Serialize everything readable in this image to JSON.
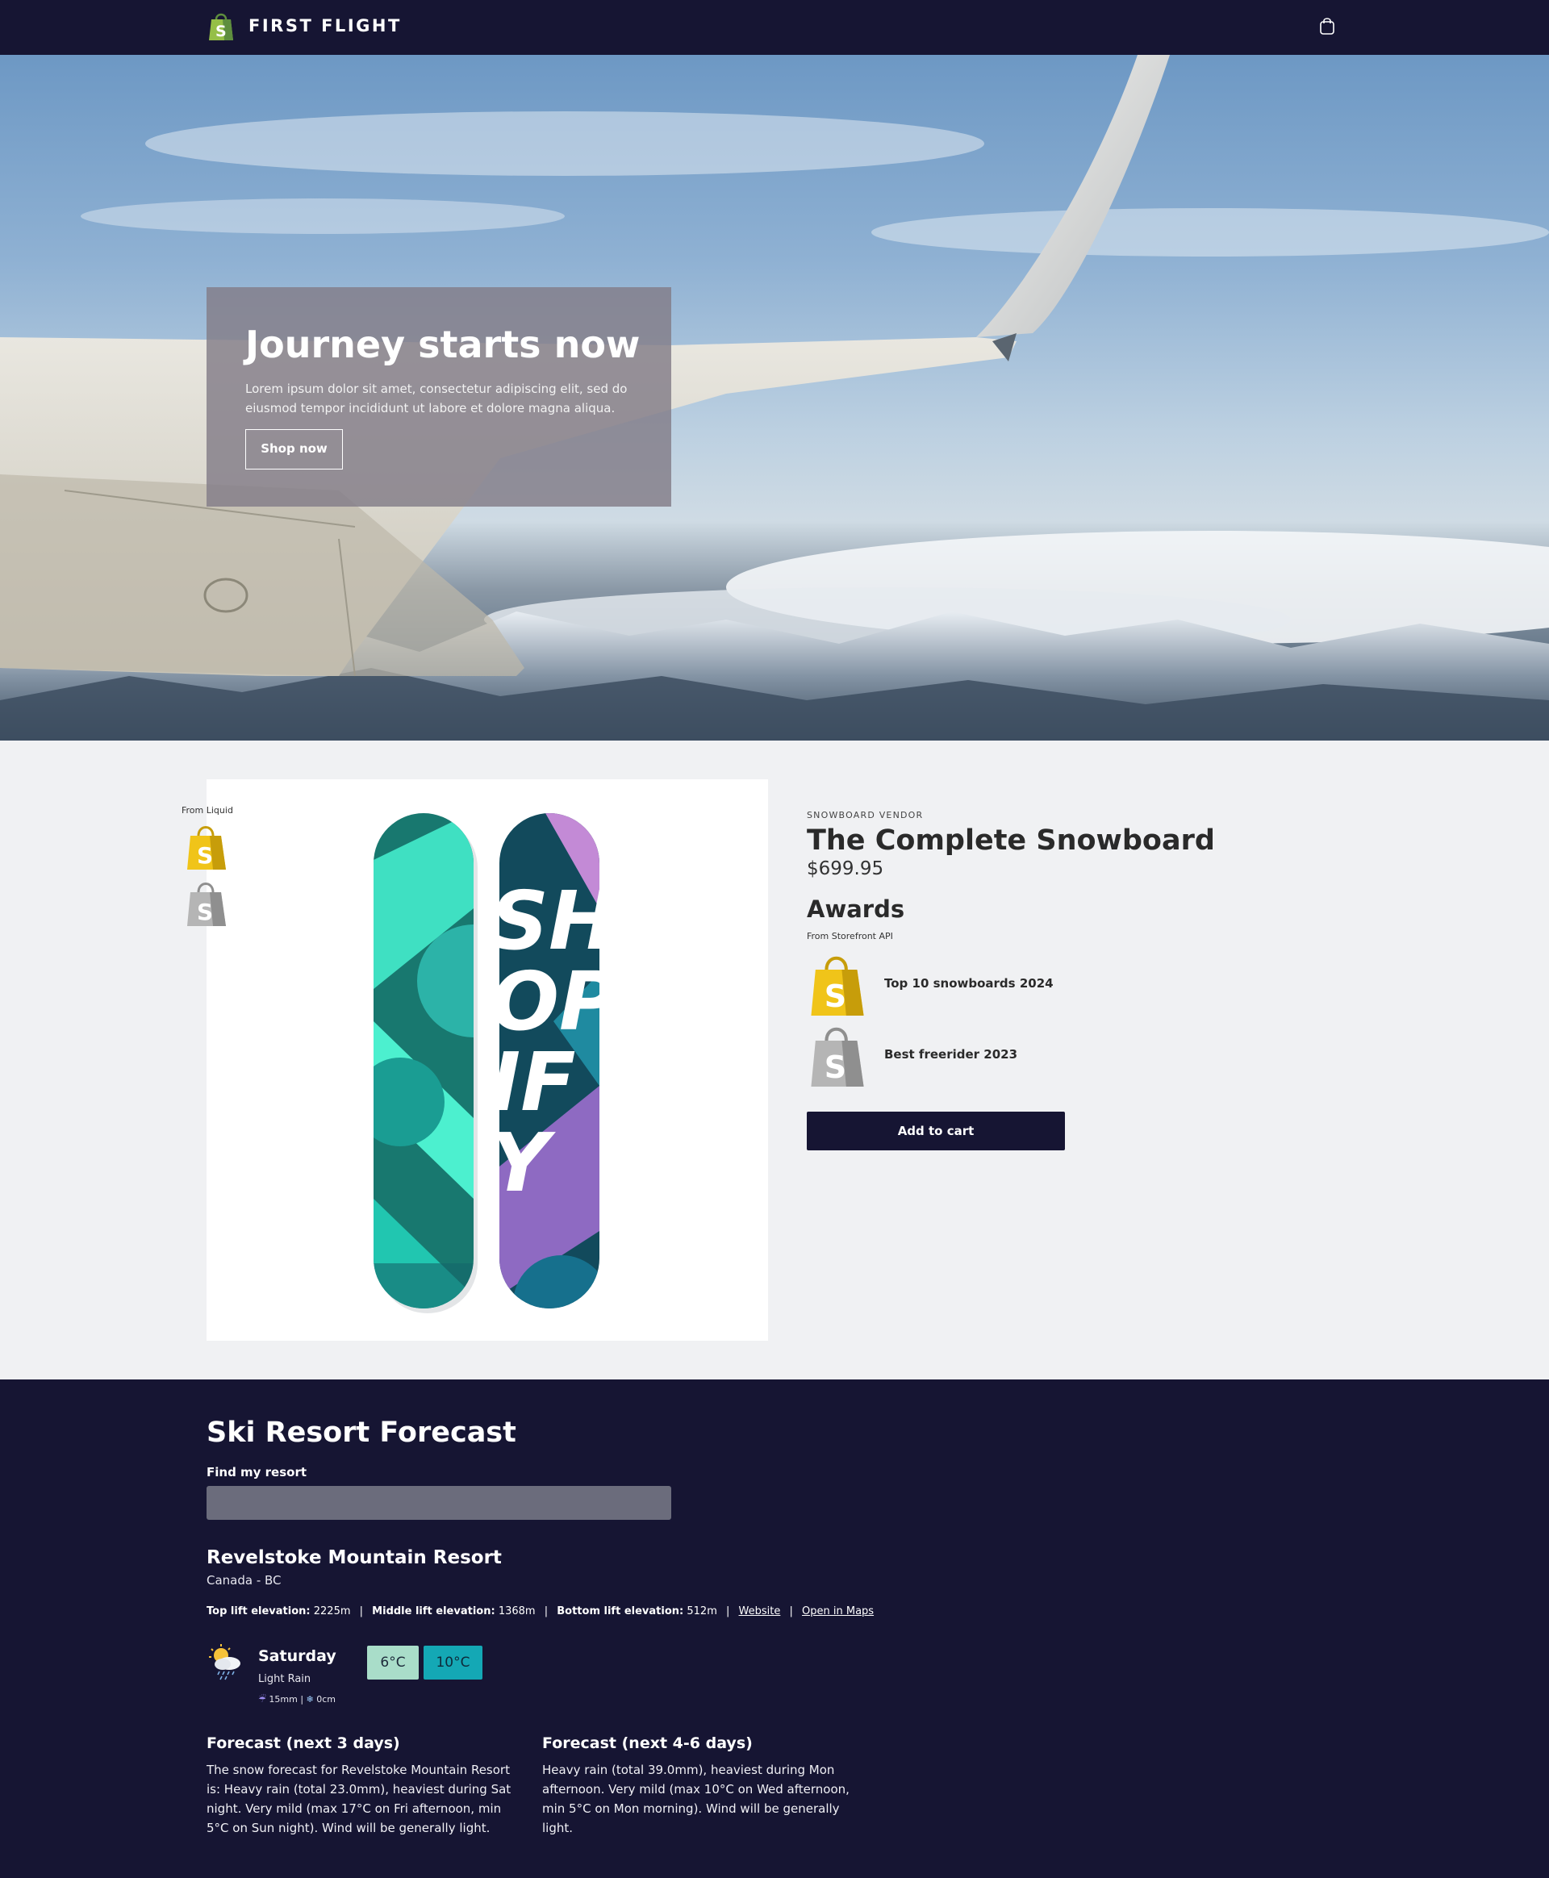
{
  "header": {
    "brand": "FIRST FLIGHT",
    "logo_icon": "shopify-bag-icon",
    "cart_icon": "shopping-bag-icon"
  },
  "hero": {
    "title": "Journey starts now",
    "text": "Lorem ipsum dolor sit amet, consectetur adipiscing elit, sed do eiusmod tempor incididunt ut labore et dolore magna aliqua.",
    "button": "Shop now"
  },
  "product": {
    "from_liquid": "From Liquid",
    "vendor": "SNOWBOARD VENDOR",
    "title": "The Complete Snowboard",
    "price": "$699.95",
    "awards_title": "Awards",
    "from_api": "From Storefront API",
    "awards": [
      {
        "label": "Top 10 snowboards 2024",
        "icon": "gold-shopify-bag-icon"
      },
      {
        "label": "Best freerider 2023",
        "icon": "silver-shopify-bag-icon"
      }
    ],
    "add_to_cart": "Add to cart",
    "board_text": "SHOPIFY"
  },
  "forecast": {
    "title": "Ski Resort Forecast",
    "search_label": "Find my resort",
    "search_value": "",
    "resort": {
      "name": "Revelstoke Mountain Resort",
      "location": "Canada - BC",
      "top_label": "Top lift elevation:",
      "top_value": "2225m",
      "middle_label": "Middle lift elevation:",
      "middle_value": "1368m",
      "bottom_label": "Bottom lift elevation:",
      "bottom_value": "512m",
      "separator": "|",
      "website": "Website",
      "maps": "Open in Maps"
    },
    "today": {
      "day": "Saturday",
      "description": "Light Rain",
      "rain": "15mm",
      "snow": "0cm",
      "precip_separator": "|",
      "min_temp": "6°C",
      "max_temp": "10°C",
      "icon": "sun-cloud-rain-icon"
    },
    "next_3": {
      "title": "Forecast (next 3 days)",
      "text": "The snow forecast for Revelstoke Mountain Resort is: Heavy rain (total 23.0mm), heaviest during Sat night. Very mild (max 17°C on Fri afternoon, min 5°C on Sun night). Wind will be generally light."
    },
    "next_4_6": {
      "title": "Forecast (next 4-6 days)",
      "text": "Heavy rain (total 39.0mm), heaviest during Mon afternoon. Very mild (max 10°C on Wed afternoon, min 5°C on Mon morning). Wind will be generally light."
    }
  }
}
